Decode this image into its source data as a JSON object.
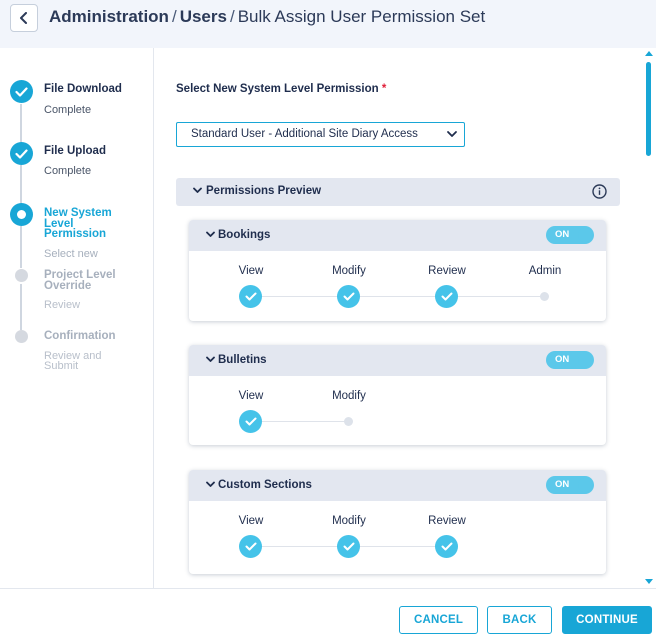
{
  "header": {
    "back_icon": "chevron-left-icon",
    "crumb1": "Administration",
    "crumb2": "Users",
    "crumb3": "Bulk Assign User Permission Set",
    "separator": "/"
  },
  "stepper": {
    "steps": [
      {
        "title": "File Download",
        "sub": "Complete",
        "state": "done"
      },
      {
        "title": "File Upload",
        "sub": "Complete",
        "state": "done"
      },
      {
        "title": "New System Level Permission",
        "sub": "Select new",
        "state": "active"
      },
      {
        "title": "Project Level Override",
        "sub": "Review",
        "state": "pending"
      },
      {
        "title": "Confirmation",
        "sub": "Review and Submit",
        "state": "pending"
      }
    ]
  },
  "form": {
    "label": "Select New System Level Permission",
    "required_mark": "*",
    "selected_value": "Standard User - Additional Site Diary Access"
  },
  "preview": {
    "title": "Permissions Preview",
    "info_icon": "info-icon"
  },
  "sections": [
    {
      "title": "Bookings",
      "toggle": "ON",
      "levels": [
        {
          "label": "View",
          "on": true
        },
        {
          "label": "Modify",
          "on": true
        },
        {
          "label": "Review",
          "on": true
        },
        {
          "label": "Admin",
          "on": false
        }
      ]
    },
    {
      "title": "Bulletins",
      "toggle": "ON",
      "levels": [
        {
          "label": "View",
          "on": true
        },
        {
          "label": "Modify",
          "on": false
        }
      ]
    },
    {
      "title": "Custom Sections",
      "toggle": "ON",
      "levels": [
        {
          "label": "View",
          "on": true
        },
        {
          "label": "Modify",
          "on": true
        },
        {
          "label": "Review",
          "on": true
        }
      ]
    }
  ],
  "footer": {
    "cancel": "CANCEL",
    "back": "BACK",
    "continue": "CONTINUE"
  },
  "colors": {
    "accent": "#18a6d6",
    "level_on": "#45c3e9",
    "toggle_on": "#5bc8ea",
    "required": "#e0203a"
  }
}
